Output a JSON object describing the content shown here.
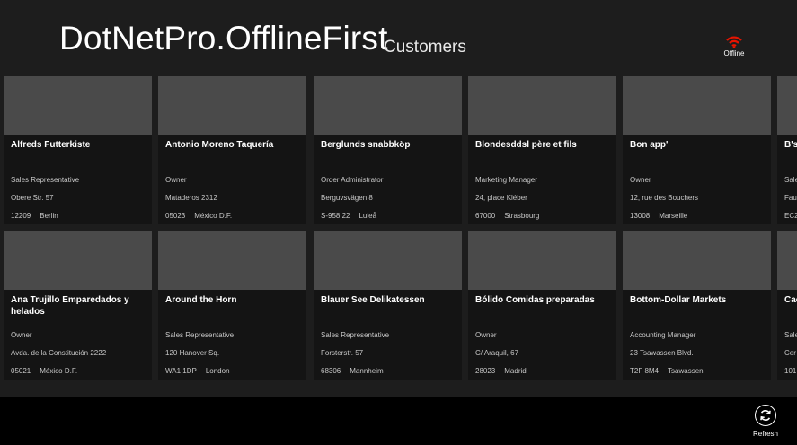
{
  "app": {
    "title": "DotNetPro.OfflineFirst",
    "page_title": "Customers"
  },
  "status": {
    "label": "Offline",
    "icon": "wifi-offline-icon",
    "color": "#e51400"
  },
  "customers": [
    {
      "name": "Alfreds Futterkiste",
      "title": "Sales Representative",
      "address": "Obere Str. 57",
      "postal": "12209",
      "city": "Berlin"
    },
    {
      "name": "Antonio Moreno Taquería",
      "title": "Owner",
      "address": "Mataderos  2312",
      "postal": "05023",
      "city": "México D.F."
    },
    {
      "name": "Berglunds snabbköp",
      "title": "Order Administrator",
      "address": "Berguvsvägen  8",
      "postal": "S-958 22",
      "city": "Luleå"
    },
    {
      "name": "Blondesddsl père et fils",
      "title": "Marketing Manager",
      "address": "24, place Kléber",
      "postal": "67000",
      "city": "Strasbourg"
    },
    {
      "name": "Bon app'",
      "title": "Owner",
      "address": "12, rue des Bouchers",
      "postal": "13008",
      "city": "Marseille"
    },
    {
      "name": "B's",
      "title": "Sale",
      "address": "Fau",
      "postal": "EC2",
      "city": ""
    },
    {
      "name": "Ana Trujillo Emparedados y helados",
      "title": "Owner",
      "address": "Avda. de la Constitución 2222",
      "postal": "05021",
      "city": "México D.F."
    },
    {
      "name": "Around the Horn",
      "title": "Sales Representative",
      "address": "120 Hanover Sq.",
      "postal": "WA1 1DP",
      "city": "London"
    },
    {
      "name": "Blauer See Delikatessen",
      "title": "Sales Representative",
      "address": "Forsterstr. 57",
      "postal": "68306",
      "city": "Mannheim"
    },
    {
      "name": "Bólido Comidas preparadas",
      "title": "Owner",
      "address": "C/ Araquil, 67",
      "postal": "28023",
      "city": "Madrid"
    },
    {
      "name": "Bottom-Dollar Markets",
      "title": "Accounting Manager",
      "address": "23 Tsawassen Blvd.",
      "postal": "T2F 8M4",
      "city": "Tsawassen"
    },
    {
      "name": "Cac",
      "title": "Sale",
      "address": "Cer",
      "postal": "101",
      "city": ""
    }
  ],
  "appbar": {
    "refresh_label": "Refresh",
    "refresh_icon": "refresh-icon"
  }
}
